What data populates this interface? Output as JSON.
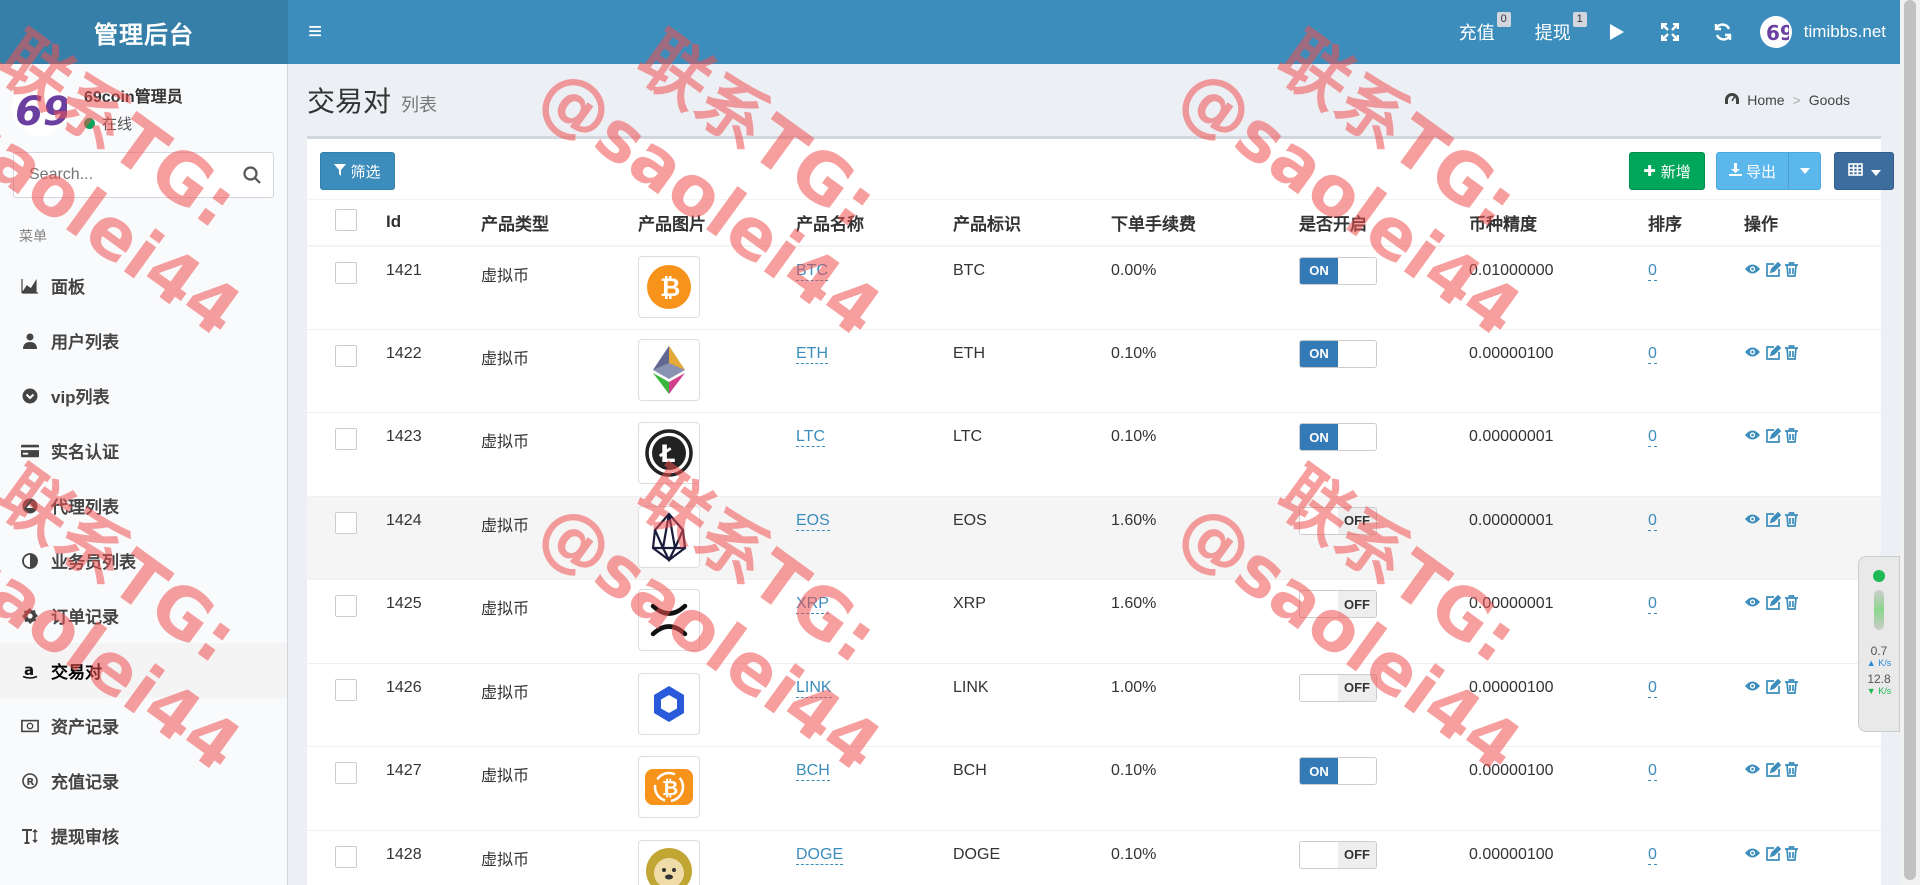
{
  "app": {
    "brand": "管理后台"
  },
  "topnav": {
    "recharge": {
      "label": "充值",
      "count": "0"
    },
    "withdraw": {
      "label": "提现",
      "count": "1"
    },
    "user_name": "timibbs.net"
  },
  "sidebar": {
    "admin_name": "69coin管理员",
    "status": "在线",
    "search_placeholder": "Search...",
    "menu_header": "菜单",
    "items": [
      {
        "label": "面板",
        "icon": "area-chart-icon"
      },
      {
        "label": "用户列表",
        "icon": "user-tie-icon"
      },
      {
        "label": "vip列表",
        "icon": "chevron-circle-icon"
      },
      {
        "label": "实名认证",
        "icon": "credit-card-icon"
      },
      {
        "label": "代理列表",
        "icon": "caret-circle-icon"
      },
      {
        "label": "业务员列表",
        "icon": "adjust-icon"
      },
      {
        "label": "订单记录",
        "icon": "gear-icon"
      },
      {
        "label": "交易对",
        "icon": "amazon-icon",
        "active": true
      },
      {
        "label": "资产记录",
        "icon": "money-icon"
      },
      {
        "label": "充值记录",
        "icon": "registered-icon"
      },
      {
        "label": "提现审核",
        "icon": "text-height-icon"
      }
    ]
  },
  "page": {
    "title": "交易对",
    "subtitle": "列表",
    "breadcrumb": [
      "Home",
      "Goods"
    ]
  },
  "toolbar": {
    "filter": "筛选",
    "add": "新增",
    "export": "导出"
  },
  "table": {
    "headers": [
      "Id",
      "产品类型",
      "产品图片",
      "产品名称",
      "产品标识",
      "下单手续费",
      "是否开启",
      "币种精度",
      "排序",
      "操作"
    ],
    "rows": [
      {
        "id": "1421",
        "type": "虚拟币",
        "name": "BTC",
        "symbol": "BTC",
        "fee": "0.00%",
        "enabled": true,
        "precision": "0.01000000",
        "sort": "0",
        "logo": "btc"
      },
      {
        "id": "1422",
        "type": "虚拟币",
        "name": "ETH",
        "symbol": "ETH",
        "fee": "0.10%",
        "enabled": true,
        "precision": "0.00000100",
        "sort": "0",
        "logo": "eth"
      },
      {
        "id": "1423",
        "type": "虚拟币",
        "name": "LTC",
        "symbol": "LTC",
        "fee": "0.10%",
        "enabled": true,
        "precision": "0.00000001",
        "sort": "0",
        "logo": "ltc"
      },
      {
        "id": "1424",
        "type": "虚拟币",
        "name": "EOS",
        "symbol": "EOS",
        "fee": "1.60%",
        "enabled": false,
        "precision": "0.00000001",
        "sort": "0",
        "logo": "eos"
      },
      {
        "id": "1425",
        "type": "虚拟币",
        "name": "XRP",
        "symbol": "XRP",
        "fee": "1.60%",
        "enabled": false,
        "precision": "0.00000001",
        "sort": "0",
        "logo": "xrp"
      },
      {
        "id": "1426",
        "type": "虚拟币",
        "name": "LINK",
        "symbol": "LINK",
        "fee": "1.00%",
        "enabled": false,
        "precision": "0.00000100",
        "sort": "0",
        "logo": "link"
      },
      {
        "id": "1427",
        "type": "虚拟币",
        "name": "BCH",
        "symbol": "BCH",
        "fee": "0.10%",
        "enabled": true,
        "precision": "0.00000100",
        "sort": "0",
        "logo": "bch"
      },
      {
        "id": "1428",
        "type": "虚拟币",
        "name": "DOGE",
        "symbol": "DOGE",
        "fee": "0.10%",
        "enabled": false,
        "precision": "0.00000100",
        "sort": "0",
        "logo": "doge"
      }
    ],
    "switch_on": "ON",
    "switch_off": "OFF"
  },
  "side_widget": {
    "up": "0.7",
    "down": "12.8",
    "unit": "K/s"
  },
  "watermark": {
    "line1": "联系TG:",
    "line2": "@saolei44"
  },
  "colors": {
    "primary": "#3c8dbc",
    "success": "#00a65a",
    "watermark": "#f05050"
  }
}
